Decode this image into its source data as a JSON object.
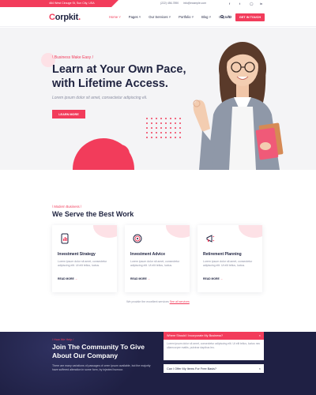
{
  "topbar": {
    "address": "464 West Circuge St, Sun City, USA",
    "phone": "(222) 456-7890",
    "email": "info@example.com"
  },
  "header": {
    "logo_first": "C",
    "logo_rest": "orpkit",
    "logo_dot": ".",
    "nav": [
      "Home ˅",
      "Pages ˅",
      "Our Services ˅",
      "Portfolio ˅",
      "Blog ˅",
      "Contact"
    ],
    "cta": "GET IN TOUCH"
  },
  "hero": {
    "eyebrow": "\\ Business Make Easy /",
    "title": "Learn at Your Own Pace, with Lifetime Access.",
    "lead": "Lorem ipsum dolor sit amet, consectetur adipiscing eli.",
    "button": "LEARN MORE"
  },
  "services": {
    "eyebrow": "\\ Modern Business /",
    "title": "We Serve the Best Work",
    "cards": [
      {
        "title": "Investment Strategy",
        "desc": "Lorem ipsum dolor sit amet, consectetur adipiscing elit. Ut elit tellus, luctus.",
        "more": "READ MORE",
        "arrow": "→",
        "icon": "phone-chart-icon"
      },
      {
        "title": "Investment Advice",
        "desc": "Lorem ipsum dolor sit amet, consectetur adipiscing elit. Ut elit tellus, luctus.",
        "more": "READ MORE",
        "arrow": "→",
        "icon": "target-icon"
      },
      {
        "title": "Retirement Planning",
        "desc": "Lorem ipsum dolor sit amet, consectetur adipiscing elit. Ut elit tellus, luctus.",
        "more": "READ MORE",
        "arrow": "→",
        "icon": "megaphone-icon"
      }
    ],
    "note_text": "We provide the excellent services ",
    "note_link": "See all services"
  },
  "community": {
    "eyebrow": "\\ How We Help /",
    "title": "Join The Community To Give About Our Company",
    "text": "There are many variations of passages of orem Ipsum available, but the majority have suffered alteration in some form, by injected humour.",
    "faq": [
      {
        "question": "Where Should I Incorporate My Business?",
        "answer": "Lorem ipsum dolor sit amet, consectetur adipiscing elit. Ut elit tellus, luctus nec ullamcorper mattis, pulvinar dapibus leo.",
        "toggle": "×"
      },
      {
        "question": "Can I Offer My Items For Free Basis?",
        "toggle": "×"
      }
    ]
  },
  "colors": {
    "accent": "#f23c5b",
    "dark": "#1f2340",
    "navy": "#1f2044"
  }
}
